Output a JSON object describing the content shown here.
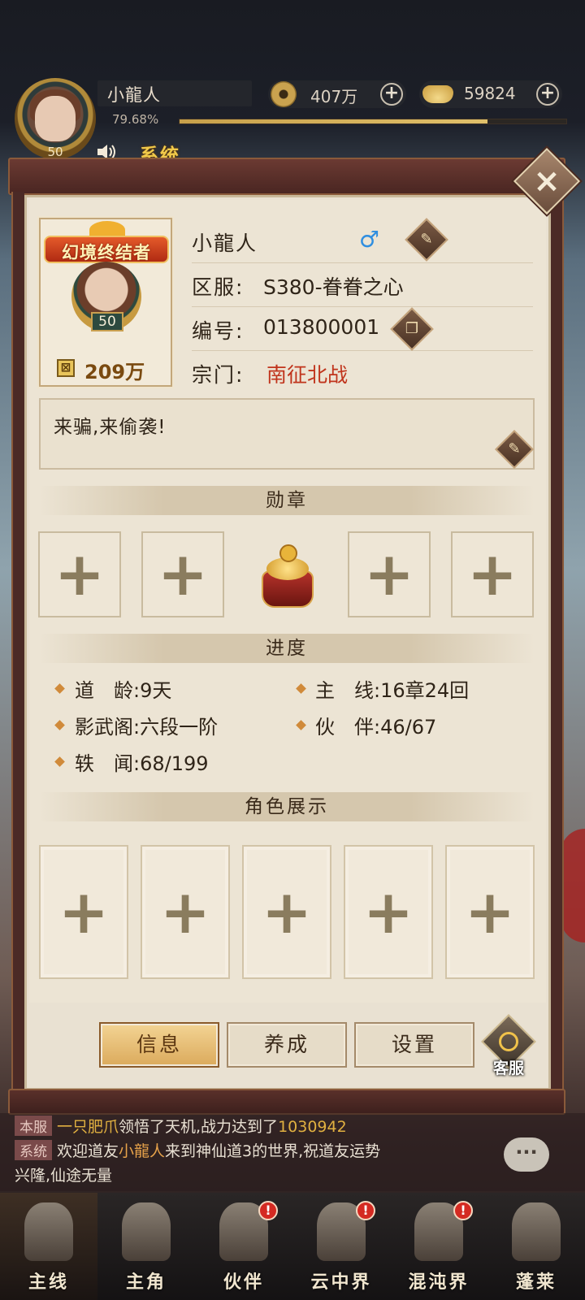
{
  "hud": {
    "player_name": "小龍人",
    "level": "50",
    "exp_percent_text": "79.68%",
    "exp_fraction": 0.7968,
    "coins": "407万",
    "ingots": "59824",
    "system_label": "系统"
  },
  "profile": {
    "card_title": "幻境终结者",
    "card_level": "50",
    "power_icon_glyph": "⊠",
    "power": "209万",
    "name": "小龍人",
    "gender_symbol": "♂",
    "server_label": "区服:",
    "server_value": "S380-眷眷之心",
    "id_label": "编号:",
    "id_value": "013800001",
    "sect_label": "宗门:",
    "sect_value": "南征北战",
    "signature": "来骗,来偷袭!"
  },
  "sections": {
    "medals": "勋章",
    "progress": "进度",
    "showcase": "角色展示"
  },
  "progress": {
    "dao_age_label": "道　龄:",
    "dao_age_value": "9天",
    "main_line_label": "主　线:",
    "main_line_value": "16章24回",
    "shadow_label": "影武阁:",
    "shadow_value": "六段一阶",
    "partner_label": "伙　伴:",
    "partner_value": "46/67",
    "rumor_label": "轶　闻:",
    "rumor_value": "68/199"
  },
  "tabs": [
    "信息",
    "养成",
    "设置"
  ],
  "customer_service": "客服",
  "chat": {
    "line1_tag": "本服",
    "line1_a": "一只肥爪",
    "line1_b": "领悟了天机,战力达到了",
    "line1_c": "1030942",
    "line2_tag": "系统",
    "line2_a": "欢迎道友",
    "line2_b": "小龍人",
    "line2_c": "来到神仙道3的世界,祝道友运势",
    "line3": "兴隆,仙途无量",
    "button_glyph": "···"
  },
  "nav": [
    {
      "label": "主线",
      "badge": ""
    },
    {
      "label": "主角",
      "badge": ""
    },
    {
      "label": "伙伴",
      "badge": "!"
    },
    {
      "label": "云中界",
      "badge": "!"
    },
    {
      "label": "混沌界",
      "badge": "!"
    },
    {
      "label": "蓬莱",
      "badge": ""
    }
  ],
  "colors": {
    "accent_gold": "#f0c94a",
    "sect_red": "#c0341c",
    "male_blue": "#2f8ee0",
    "badge_red": "#d42a22"
  }
}
